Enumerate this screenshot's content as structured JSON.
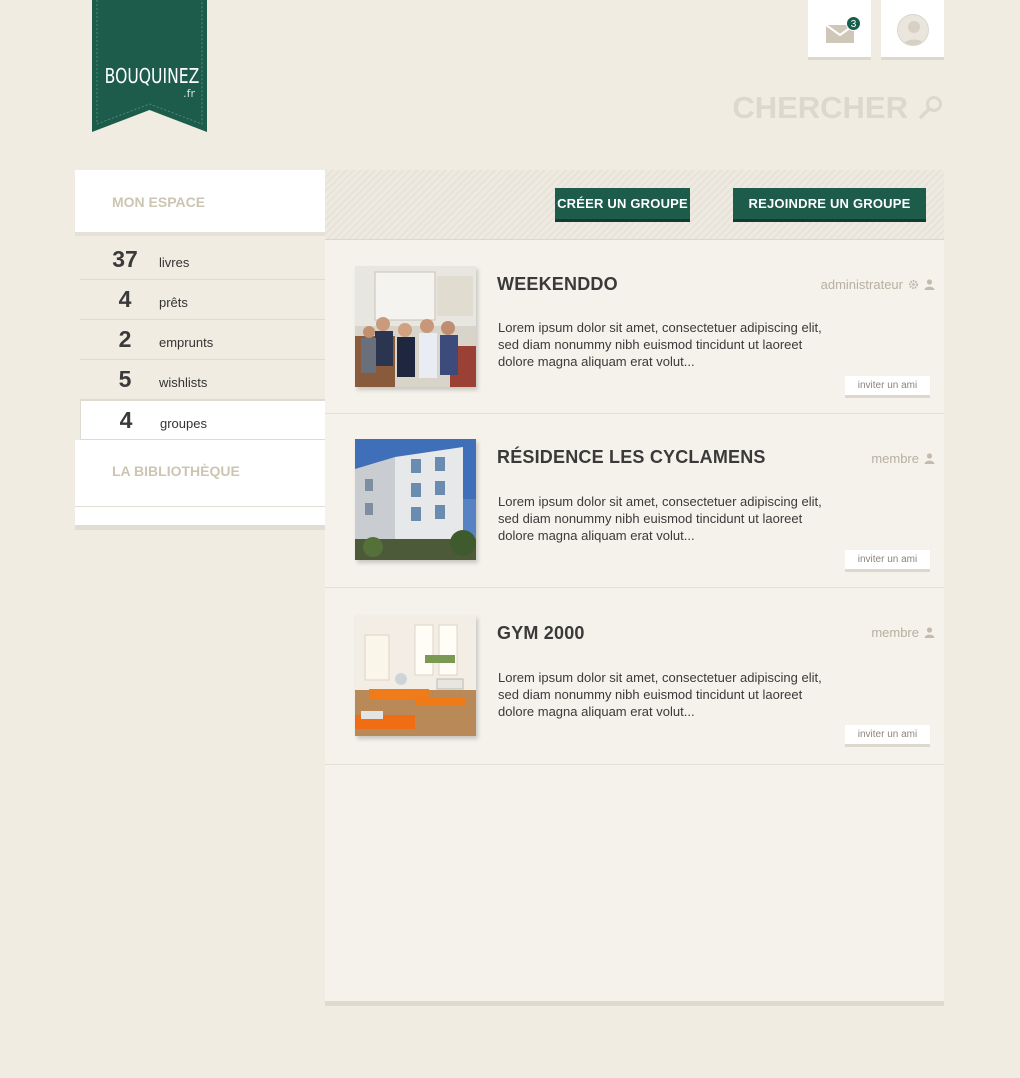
{
  "brand": {
    "name": "BOUQUINEZ",
    "tld": ".fr",
    "color": "#1d5c4b"
  },
  "header": {
    "mail_count": "3",
    "search_placeholder": "CHERCHER"
  },
  "sidebar": {
    "title": "MON ESPACE",
    "stats": [
      {
        "num": "37",
        "label": "livres"
      },
      {
        "num": "4",
        "label": "prêts"
      },
      {
        "num": "2",
        "label": "emprunts"
      },
      {
        "num": "5",
        "label": "wishlists"
      },
      {
        "num": "4",
        "label": "groupes"
      }
    ],
    "library_title": "LA BIBLIOTHÈQUE"
  },
  "toolbar": {
    "create_label": "CRÉER UN GROUPE",
    "join_label": "REJOINDRE UN GROUPE"
  },
  "groups": [
    {
      "name": "WEEKENDDO",
      "role": "administrateur",
      "role_icons": [
        "gear-icon",
        "user-icon"
      ],
      "description": "Lorem ipsum dolor sit amet, consectetuer adipiscing elit, sed diam nonummy nibh euismod tincidunt ut laoreet dolore magna aliquam erat volut...",
      "invite_label": "inviter un ami"
    },
    {
      "name": "RÉSIDENCE LES CYCLAMENS",
      "role": "membre",
      "role_icons": [
        "user-icon"
      ],
      "description": "Lorem ipsum dolor sit amet, consectetuer adipiscing elit, sed diam nonummy nibh euismod tincidunt ut laoreet dolore magna aliquam erat volut...",
      "invite_label": "inviter un ami"
    },
    {
      "name": "GYM 2000",
      "role": "membre",
      "role_icons": [
        "user-icon"
      ],
      "description": "Lorem ipsum dolor sit amet, consectetuer adipiscing elit, sed diam nonummy nibh euismod tincidunt ut laoreet dolore magna aliquam erat volut...",
      "invite_label": "inviter un ami"
    }
  ]
}
